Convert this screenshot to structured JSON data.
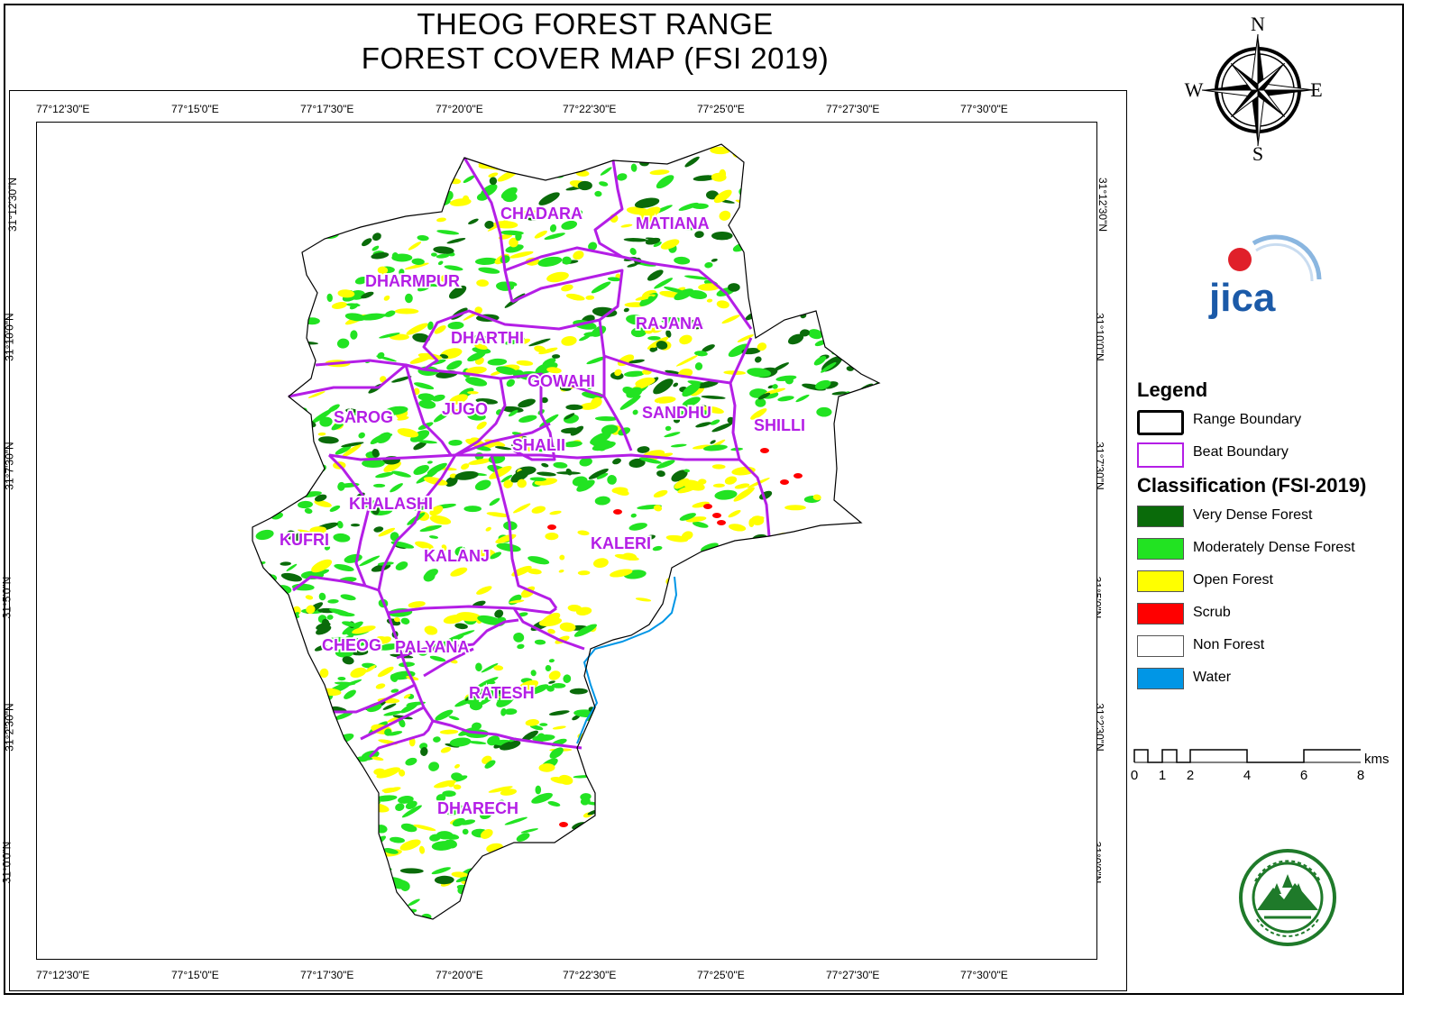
{
  "title": {
    "line1": "THEOG FOREST RANGE",
    "line2": "FOREST COVER MAP (FSI 2019)"
  },
  "graticule": {
    "longitudes": [
      "77°12'30\"E",
      "77°15'0\"E",
      "77°17'30\"E",
      "77°20'0\"E",
      "77°22'30\"E",
      "77°25'0\"E",
      "77°27'30\"E",
      "77°30'0\"E"
    ],
    "latitudes": [
      "31°12'30\"N",
      "31°10'0\"N",
      "31°7'30\"N",
      "31°5'0\"N",
      "31°2'30\"N",
      "31°0'0\"N"
    ]
  },
  "compass": {
    "north": "N",
    "south": "S",
    "east": "E",
    "west": "W"
  },
  "logos": {
    "jica_text": "JICA",
    "seal_text": "Himachal Pradesh Forest Department"
  },
  "beats": [
    {
      "name": "CHADARA"
    },
    {
      "name": "MATIANA"
    },
    {
      "name": "DHARMPUR"
    },
    {
      "name": "RAJANA"
    },
    {
      "name": "DHARTHI"
    },
    {
      "name": "GOWAHI"
    },
    {
      "name": "SAROG"
    },
    {
      "name": "JUGO"
    },
    {
      "name": "SANDHU"
    },
    {
      "name": "SHILLI"
    },
    {
      "name": "SHALII"
    },
    {
      "name": "KHALASHI"
    },
    {
      "name": "KUFRI"
    },
    {
      "name": "KALANJ"
    },
    {
      "name": "KALERI"
    },
    {
      "name": "CHEOG"
    },
    {
      "name": "PALYANA"
    },
    {
      "name": "RATESH"
    },
    {
      "name": "DHARECH"
    }
  ],
  "legend": {
    "title": "Legend",
    "boundaries": [
      {
        "label": "Range Boundary",
        "color": "#000000"
      },
      {
        "label": "Beat Boundary",
        "color": "#b41ee6"
      }
    ],
    "classification_title": "Classification (FSI-2019)",
    "classes": [
      {
        "label": "Very Dense Forest",
        "color": "#0a6b0a"
      },
      {
        "label": "Moderately Dense Forest",
        "color": "#22e322"
      },
      {
        "label": "Open Forest",
        "color": "#ffff00"
      },
      {
        "label": "Scrub",
        "color": "#ff0000"
      },
      {
        "label": "Non Forest",
        "color": "#ffffff"
      },
      {
        "label": "Water",
        "color": "#0096e6"
      }
    ]
  },
  "scalebar": {
    "ticks": [
      "0",
      "1",
      "1",
      "2",
      "4",
      "6",
      "8"
    ],
    "unit": "kms"
  }
}
